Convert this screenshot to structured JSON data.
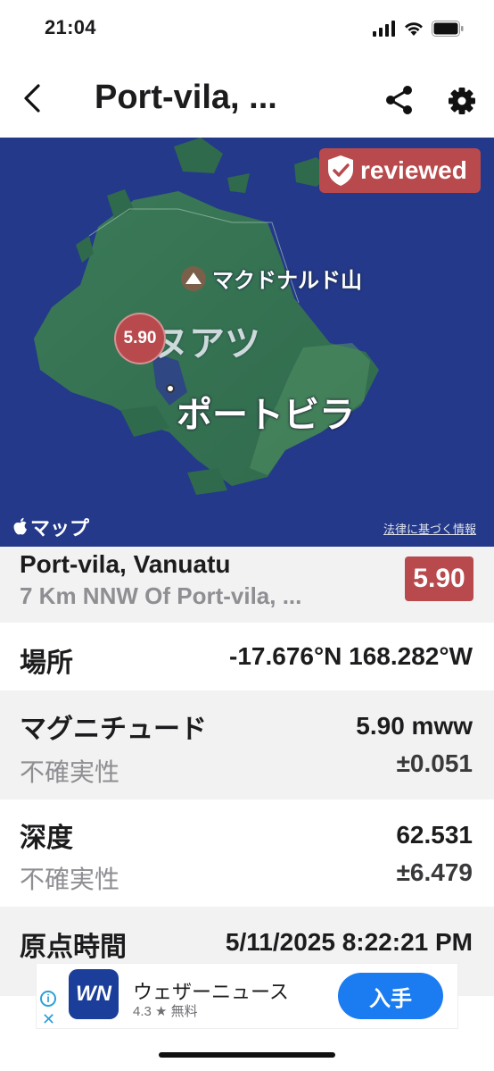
{
  "status_bar": {
    "time": "21:04"
  },
  "nav": {
    "title": "Port-vila, ..."
  },
  "map": {
    "badge_label": "reviewed",
    "poi_label": "マクドナルド山",
    "country_label": "ヌアツ",
    "city_label": "ポートビラ",
    "marker_value": "5.90",
    "brand_label": "マップ",
    "legal_link": "法律に基づく情報"
  },
  "quake": {
    "place": "Port-vila, Vanuatu",
    "subtitle": "7 Km NNW Of Port-vila, ...",
    "magnitude_badge": "5.90",
    "badge_color": "#b84a4d"
  },
  "details": {
    "location": {
      "label": "場所",
      "value": "-17.676°N 168.282°W"
    },
    "magnitude": {
      "label": "マグニチュード",
      "value": "5.90 mww",
      "uncert_label": "不確実性",
      "uncert_value": "±0.051"
    },
    "depth": {
      "label": "深度",
      "value": "62.531",
      "uncert_label": "不確実性",
      "uncert_value": "±6.479"
    },
    "origin_time": {
      "label": "原点時間",
      "value": "5/11/2025 8:22:21 PM"
    }
  },
  "ad": {
    "app_icon_text": "WN",
    "app_name": "ウェザーニュース",
    "rating": "4.3 ★  無料",
    "install_label": "入手"
  },
  "colors": {
    "accent": "#b84a4d",
    "install": "#1a7cf0",
    "map_sea": "#24398a",
    "map_land": "#3f7a5a"
  }
}
